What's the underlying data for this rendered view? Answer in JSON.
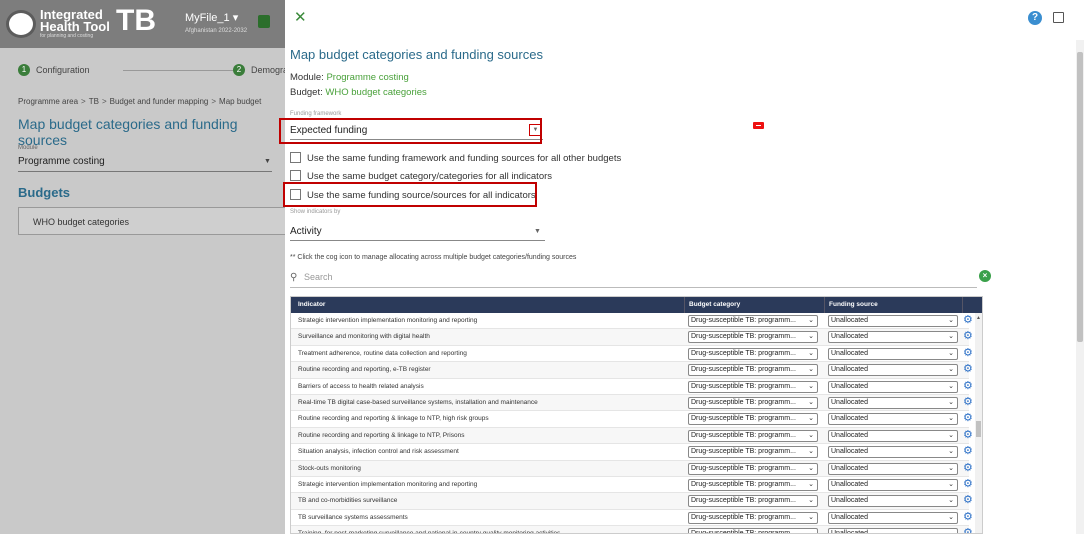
{
  "background_app": {
    "logo": {
      "line1": "Integrated",
      "line2": "Health Tool",
      "abbr": "TB",
      "tagline": "for planning and costing"
    },
    "file": {
      "name": "MyFile_1",
      "caret": "▾",
      "subtitle": "Afghanistan 2022-2032"
    },
    "steps": [
      {
        "num": "1",
        "label": "Configuration"
      },
      {
        "num": "2",
        "label": "Demograp"
      }
    ],
    "breadcrumb": [
      "Programme area",
      "TB",
      "Budget and funder mapping",
      "Map budget"
    ],
    "breadcrumb_sep": ">",
    "title": "Map budget categories and funding sources",
    "module_label": "Module",
    "module_value": "Programme costing",
    "budgets_heading": "Budgets",
    "budget_item": "WHO budget categories"
  },
  "panel": {
    "close_icon": "✕",
    "help_icon": "?",
    "title": "Map budget categories and funding sources",
    "module_prefix": "Module: ",
    "module_value": "Programme costing",
    "budget_prefix": "Budget: ",
    "budget_value": "WHO budget categories",
    "funding_framework": {
      "label": "Funding framework",
      "value": "Expected funding",
      "caret": "▼"
    },
    "checkboxes": [
      {
        "label": "Use the same funding framework and funding sources for all other budgets",
        "checked": false
      },
      {
        "label": "Use the same budget category/categories for all indicators",
        "checked": false
      },
      {
        "label": "Use the same funding source/sources for all indicators",
        "checked": false
      }
    ],
    "show_indicators": {
      "label": "Show indicators by",
      "value": "Activity",
      "caret": "▼"
    },
    "note": "** Click the cog icon to manage allocating across multiple budget categories/funding sources",
    "search": {
      "placeholder": "Search",
      "icon": "⚲",
      "clear_icon": "×"
    },
    "table": {
      "headers": {
        "indicator": "Indicator",
        "budget_category": "Budget category",
        "funding_source": "Funding source"
      },
      "rows": [
        {
          "indicator": "Strategic intervention implementation monitoring and reporting",
          "budget_category": "Drug-susceptible TB: programm...",
          "funding_source": "Unallocated"
        },
        {
          "indicator": "Surveillance and monitoring with digital health",
          "budget_category": "Drug-susceptible TB: programm...",
          "funding_source": "Unallocated"
        },
        {
          "indicator": "Treatment adherence, routine data collection and reporting",
          "budget_category": "Drug-susceptible TB: programm...",
          "funding_source": "Unallocated"
        },
        {
          "indicator": "Routine recording and reporting, e-TB register",
          "budget_category": "Drug-susceptible TB: programm...",
          "funding_source": "Unallocated"
        },
        {
          "indicator": "Barriers of access to health related analysis",
          "budget_category": "Drug-susceptible TB: programm...",
          "funding_source": "Unallocated"
        },
        {
          "indicator": "Real-time TB digital case-based surveillance systems, installation and maintenance",
          "budget_category": "Drug-susceptible TB: programm...",
          "funding_source": "Unallocated"
        },
        {
          "indicator": "Routine recording and reporting & linkage to NTP, high risk groups",
          "budget_category": "Drug-susceptible TB: programm...",
          "funding_source": "Unallocated"
        },
        {
          "indicator": "Routine recording and reporting & linkage to NTP, Prisons",
          "budget_category": "Drug-susceptible TB: programm...",
          "funding_source": "Unallocated"
        },
        {
          "indicator": "Situation analysis, infection control and risk assessment",
          "budget_category": "Drug-susceptible TB: programm...",
          "funding_source": "Unallocated"
        },
        {
          "indicator": "Stock-outs monitoring",
          "budget_category": "Drug-susceptible TB: programm...",
          "funding_source": "Unallocated"
        },
        {
          "indicator": "Strategic intervention implementation monitoring and reporting",
          "budget_category": "Drug-susceptible TB: programm...",
          "funding_source": "Unallocated"
        },
        {
          "indicator": "TB and co-morbidities surveillance",
          "budget_category": "Drug-susceptible TB: programm...",
          "funding_source": "Unallocated"
        },
        {
          "indicator": "TB surveillance systems assessments",
          "budget_category": "Drug-susceptible TB: programm...",
          "funding_source": "Unallocated"
        },
        {
          "indicator": "Training, for post-marketing surveillance and national in-country quality monitoring activities",
          "budget_category": "Drug-susceptible TB: programm...",
          "funding_source": "Unallocated"
        }
      ],
      "select_chevron": "⌄",
      "cog_icon": "⚙"
    }
  },
  "colors": {
    "accent": "#2a6a8a",
    "green": "#4aa13b",
    "header": "#2b3a5a",
    "highlight": "#c00000",
    "cog": "#2b6fc6"
  }
}
